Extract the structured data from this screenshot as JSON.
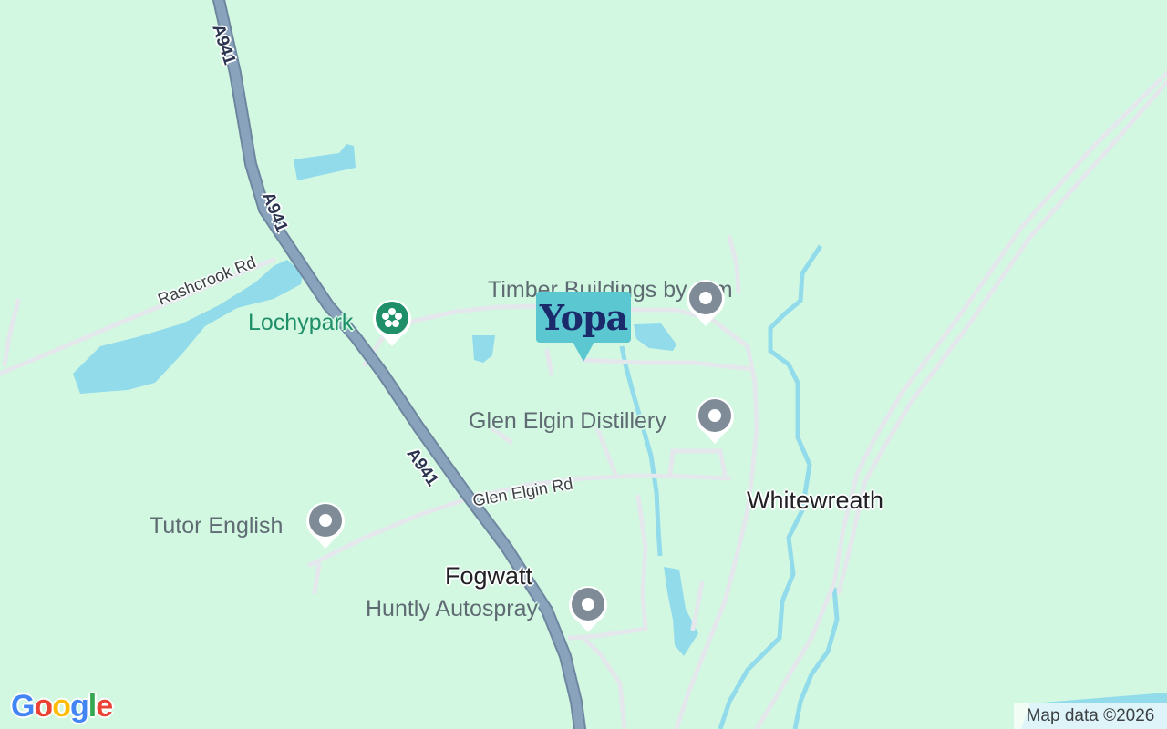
{
  "map": {
    "colors": {
      "land": "#d3f8e2",
      "water": "#91dbeb",
      "highway": "#8aa3bc",
      "minor_road": "#e4e8ec",
      "poi_grey": "#7f8c97",
      "poi_green": "#1e8f68",
      "brand": "#5bc8d1"
    },
    "places": [
      {
        "name": "Whitewreath"
      },
      {
        "name": "Fogwatt"
      }
    ],
    "pois": [
      {
        "name": "Timber Buildings by Sim",
        "icon": "map-pin-icon"
      },
      {
        "name": "Lochypark",
        "icon": "flower-icon"
      },
      {
        "name": "Glen Elgin Distillery",
        "icon": "map-pin-icon"
      },
      {
        "name": "Tutor English",
        "icon": "map-pin-icon"
      },
      {
        "name": "Huntly Autospray",
        "icon": "map-pin-icon"
      }
    ],
    "roads": {
      "highway": "A941",
      "minor": [
        "Rashcrook Rd",
        "Glen Elgin Rd"
      ]
    },
    "brand_marker": {
      "text": "Yopa",
      "icon": "yopa-logo-marker"
    },
    "footer": {
      "logo": "Google",
      "attribution": "Map data ©2026"
    }
  }
}
